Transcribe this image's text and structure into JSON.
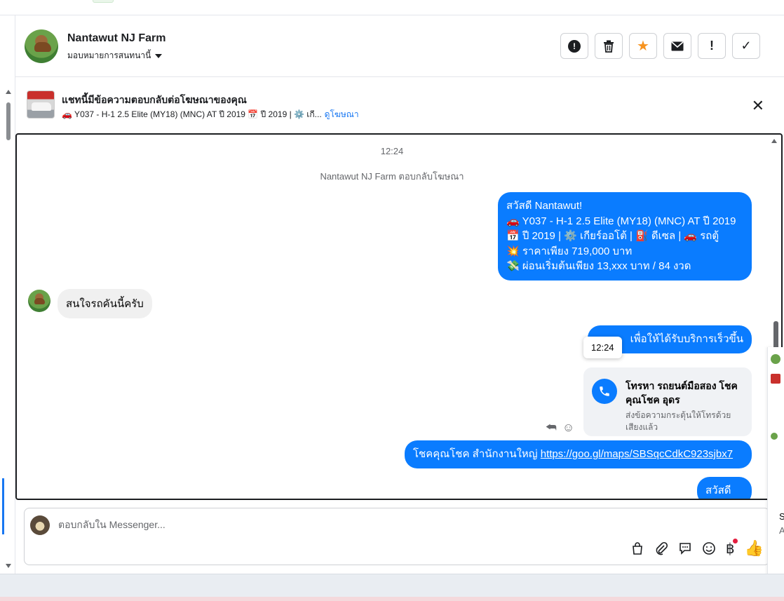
{
  "header": {
    "name": "Nantawut NJ Farm",
    "assign_label": "มอบหมายการสนทนานี้"
  },
  "actions": [
    {
      "name": "report-icon",
      "glyph": "⬤"
    },
    {
      "name": "trash-icon",
      "glyph": "🗑"
    },
    {
      "name": "star-icon",
      "glyph": "★"
    },
    {
      "name": "mail-icon",
      "glyph": "✉"
    },
    {
      "name": "exclamation-icon",
      "glyph": "!"
    },
    {
      "name": "check-icon",
      "glyph": "✓"
    }
  ],
  "ad_banner": {
    "title": "แชทนี้มีข้อความตอบกลับต่อโฆษณาของคุณ",
    "description": "🚗 Y037 - H-1 2.5 Elite (MY18) (MNC) AT ปี 2019 📅 ปี 2019 | ⚙️ เกี...",
    "link_label": "ดูโฆษณา",
    "close_glyph": "✕"
  },
  "messages": {
    "timestamp_top": "12:24",
    "system_note": "Nantawut NJ Farm ตอบกลับโฆษณา",
    "outgoing_ad_lines": [
      "สวัสดี Nantawut!",
      "🚗 Y037 - H-1 2.5 Elite (MY18) (MNC) AT ปี 2019",
      "📅 ปี 2019 | ⚙️ เกียร์ออโต้ | ⛽ ดีเซล | 🚗 รถตู้",
      "💥 ราคาเพียง 719,000 บาท",
      "💸 ผ่อนเริ่มต้นเพียง 13,xxx บาท / 84 งวด"
    ],
    "incoming_text": "สนใจรถคันนี้ครับ",
    "outgoing_partial": "เพื่อให้ได้รับบริการเร็วขึ้น",
    "tooltip_time": "12:24",
    "call_card": {
      "title": "โทรหา รถยนต์มือสอง โชคคุณโชค อุดร",
      "subtitle": "ส่งข้อความกระตุ้นให้โทรด้วยเสียงแล้ว"
    },
    "hq_text": "โชคคุณโชค สำนักงานใหญ่",
    "hq_link": "https://goo.gl/maps/SBSqcCdkC923sjbx7",
    "greeting": "สวัสดีคะ"
  },
  "composer": {
    "placeholder": "ตอบกลับใน Messenger..."
  },
  "right_fragment": {
    "letter_1": "S",
    "letter_2": "A"
  },
  "colors": {
    "accent": "#0a7cff",
    "star": "#f7931e",
    "badge": "#e41e3f"
  }
}
